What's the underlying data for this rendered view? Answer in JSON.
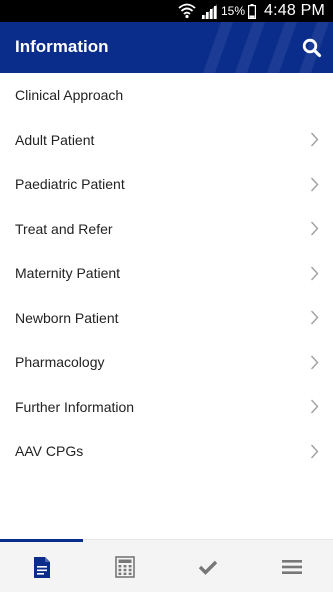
{
  "status_bar": {
    "battery_percent": "15%",
    "time": "4:48 PM"
  },
  "header": {
    "title": "Information",
    "icons": [
      "search-icon"
    ],
    "color": "#0a2d8c"
  },
  "menu": {
    "items": [
      {
        "label": "Clinical Approach",
        "has_chevron": false
      },
      {
        "label": "Adult Patient",
        "has_chevron": true
      },
      {
        "label": "Paediatric Patient",
        "has_chevron": true
      },
      {
        "label": "Treat and Refer",
        "has_chevron": true
      },
      {
        "label": "Maternity Patient",
        "has_chevron": true
      },
      {
        "label": "Newborn Patient",
        "has_chevron": true
      },
      {
        "label": "Pharmacology",
        "has_chevron": true
      },
      {
        "label": "Further Information",
        "has_chevron": true
      },
      {
        "label": "AAV CPGs",
        "has_chevron": true
      }
    ]
  },
  "bottom_nav": {
    "tabs": [
      {
        "icon": "document-icon",
        "active": true
      },
      {
        "icon": "calculator-icon",
        "active": false
      },
      {
        "icon": "checkmark-icon",
        "active": false
      },
      {
        "icon": "hamburger-menu-icon",
        "active": false
      }
    ]
  }
}
